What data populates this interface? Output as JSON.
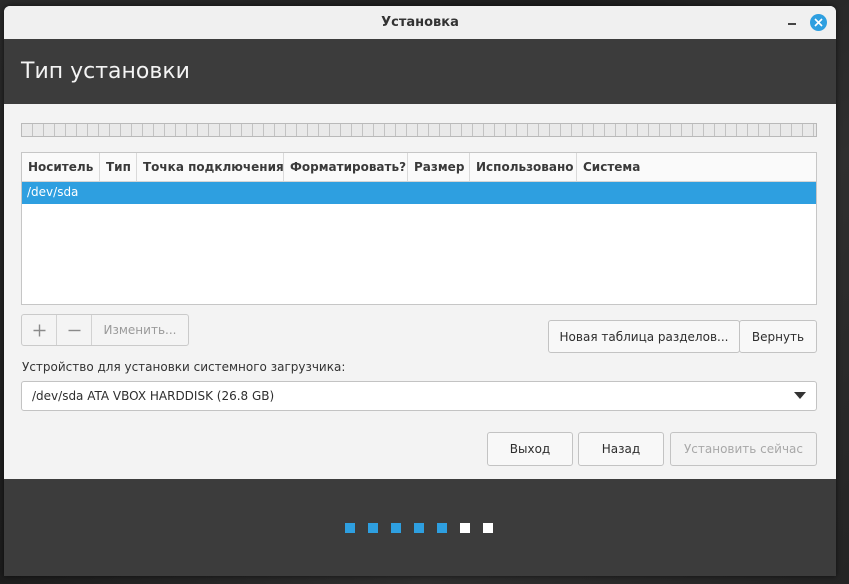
{
  "window": {
    "title": "Установка",
    "minimize_icon": "minimize-icon",
    "close_icon": "close-icon"
  },
  "header": {
    "title": "Тип установки"
  },
  "partition_table": {
    "columns": [
      "Носитель",
      "Тип",
      "Точка подключения",
      "Форматировать?",
      "Размер",
      "Использовано",
      "Система"
    ],
    "rows": [
      {
        "device": "/dev/sda",
        "selected": true
      }
    ]
  },
  "toolbar": {
    "add_label": "+",
    "remove_label": "—",
    "change_label": "Изменить...",
    "new_table_label": "Новая таблица разделов...",
    "revert_label": "Вернуть"
  },
  "bootloader": {
    "label": "Устройство для установки системного загрузчика:",
    "selected": "/dev/sda ATA VBOX HARDDISK (26.8 GB)"
  },
  "actions": {
    "quit_label": "Выход",
    "back_label": "Назад",
    "install_label": "Установить сейчас"
  },
  "progress": {
    "steps_total": 7,
    "steps_done": 5
  },
  "colors": {
    "accent": "#2e9fe0",
    "header_bg": "#3c3c3c"
  }
}
